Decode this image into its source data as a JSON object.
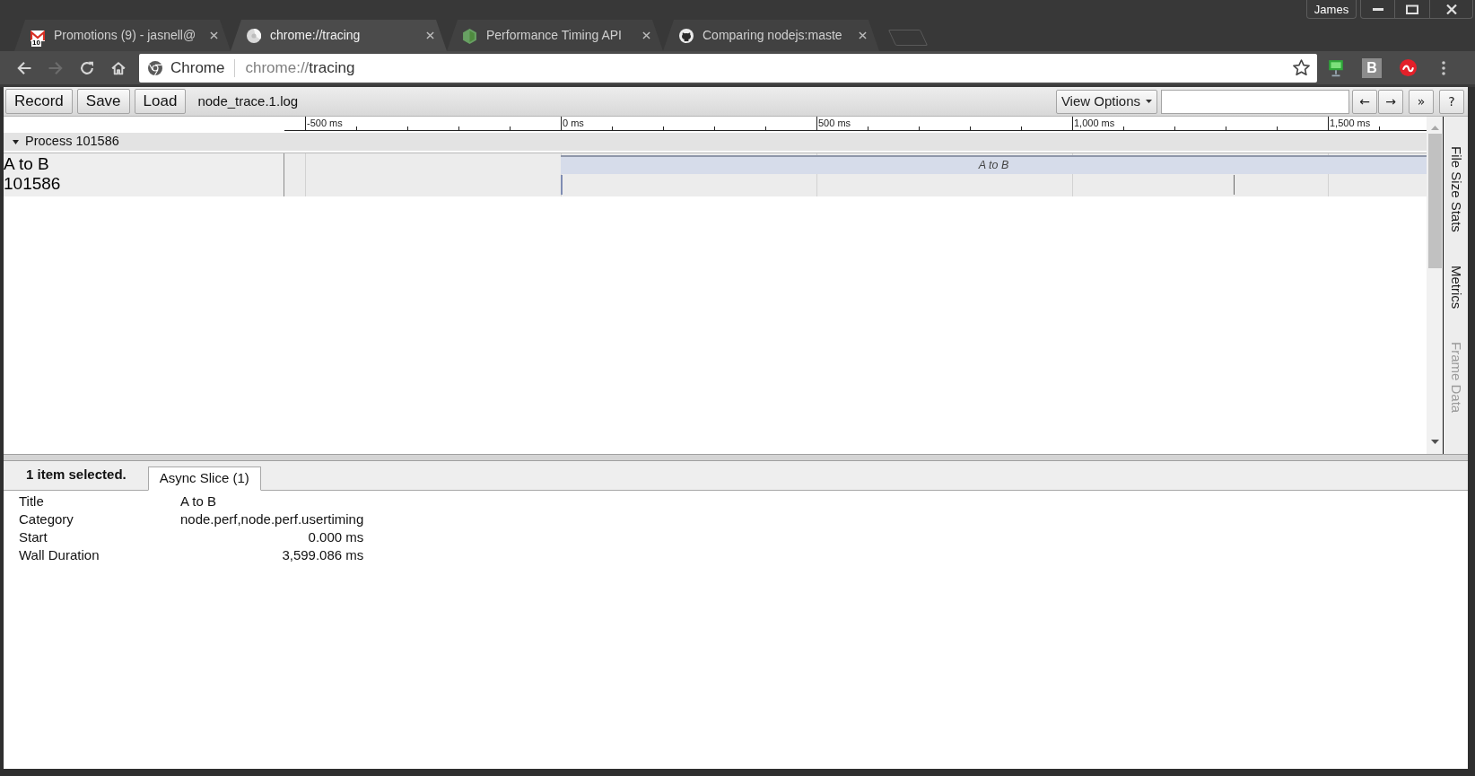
{
  "window": {
    "profile": "James"
  },
  "tabs": [
    {
      "kind": "mail",
      "title": "Promotions (9) - jasnell@",
      "badge": "10",
      "selected": false
    },
    {
      "kind": "circle",
      "title": "chrome://tracing",
      "selected": true
    },
    {
      "kind": "hexagon",
      "title": "Performance Timing API",
      "selected": false
    },
    {
      "kind": "cat",
      "title": "Comparing nodejs:maste",
      "selected": false
    }
  ],
  "navigation": [
    {
      "kind": "back",
      "disabled": false
    },
    {
      "kind": "forward",
      "disabled": true
    },
    {
      "kind": "reload",
      "disabled": false
    },
    {
      "kind": "home",
      "disabled": false
    }
  ],
  "omnibox": {
    "chip": "Chrome",
    "url_scheme": "chrome://",
    "url_path": "tracing"
  },
  "extensions": [
    {
      "kind": "monitor"
    },
    {
      "kind": "tile",
      "letter": "B"
    },
    {
      "kind": "wave"
    }
  ],
  "tracing_toolbar": {
    "buttons": [
      "Record",
      "Save",
      "Load"
    ],
    "file_name": "node_trace.1.log",
    "view_options": "View Options",
    "nav_buttons": [
      "←",
      "→",
      "»",
      "?"
    ]
  },
  "ruler": {
    "labels": [
      "-500 ms",
      "0 ms",
      "500 ms",
      "1,000 ms",
      "1,500 ms"
    ]
  },
  "process": {
    "title": "Process 101586",
    "expanded": true,
    "track": {
      "name": "A to B",
      "id": "101586",
      "slices": [
        {
          "title": "A to B"
        }
      ]
    }
  },
  "side_tabs": [
    {
      "label": "File Size Stats",
      "disabled": false
    },
    {
      "label": "Metrics",
      "disabled": false
    },
    {
      "label": "Frame Data",
      "disabled": true
    }
  ],
  "details": {
    "summary": "1 item selected.",
    "tabs": [
      {
        "label": "Async Slice (1)",
        "selected": true
      }
    ],
    "rows": [
      {
        "label": "Title",
        "value": "A to B",
        "kind": "text"
      },
      {
        "label": "Category",
        "value": "node.perf,node.perf.usertiming",
        "kind": "text"
      },
      {
        "label": "Start",
        "value": "0.000 ms",
        "kind": "number"
      },
      {
        "label": "Wall Duration",
        "value": "3,599.086 ms",
        "kind": "number"
      }
    ]
  }
}
